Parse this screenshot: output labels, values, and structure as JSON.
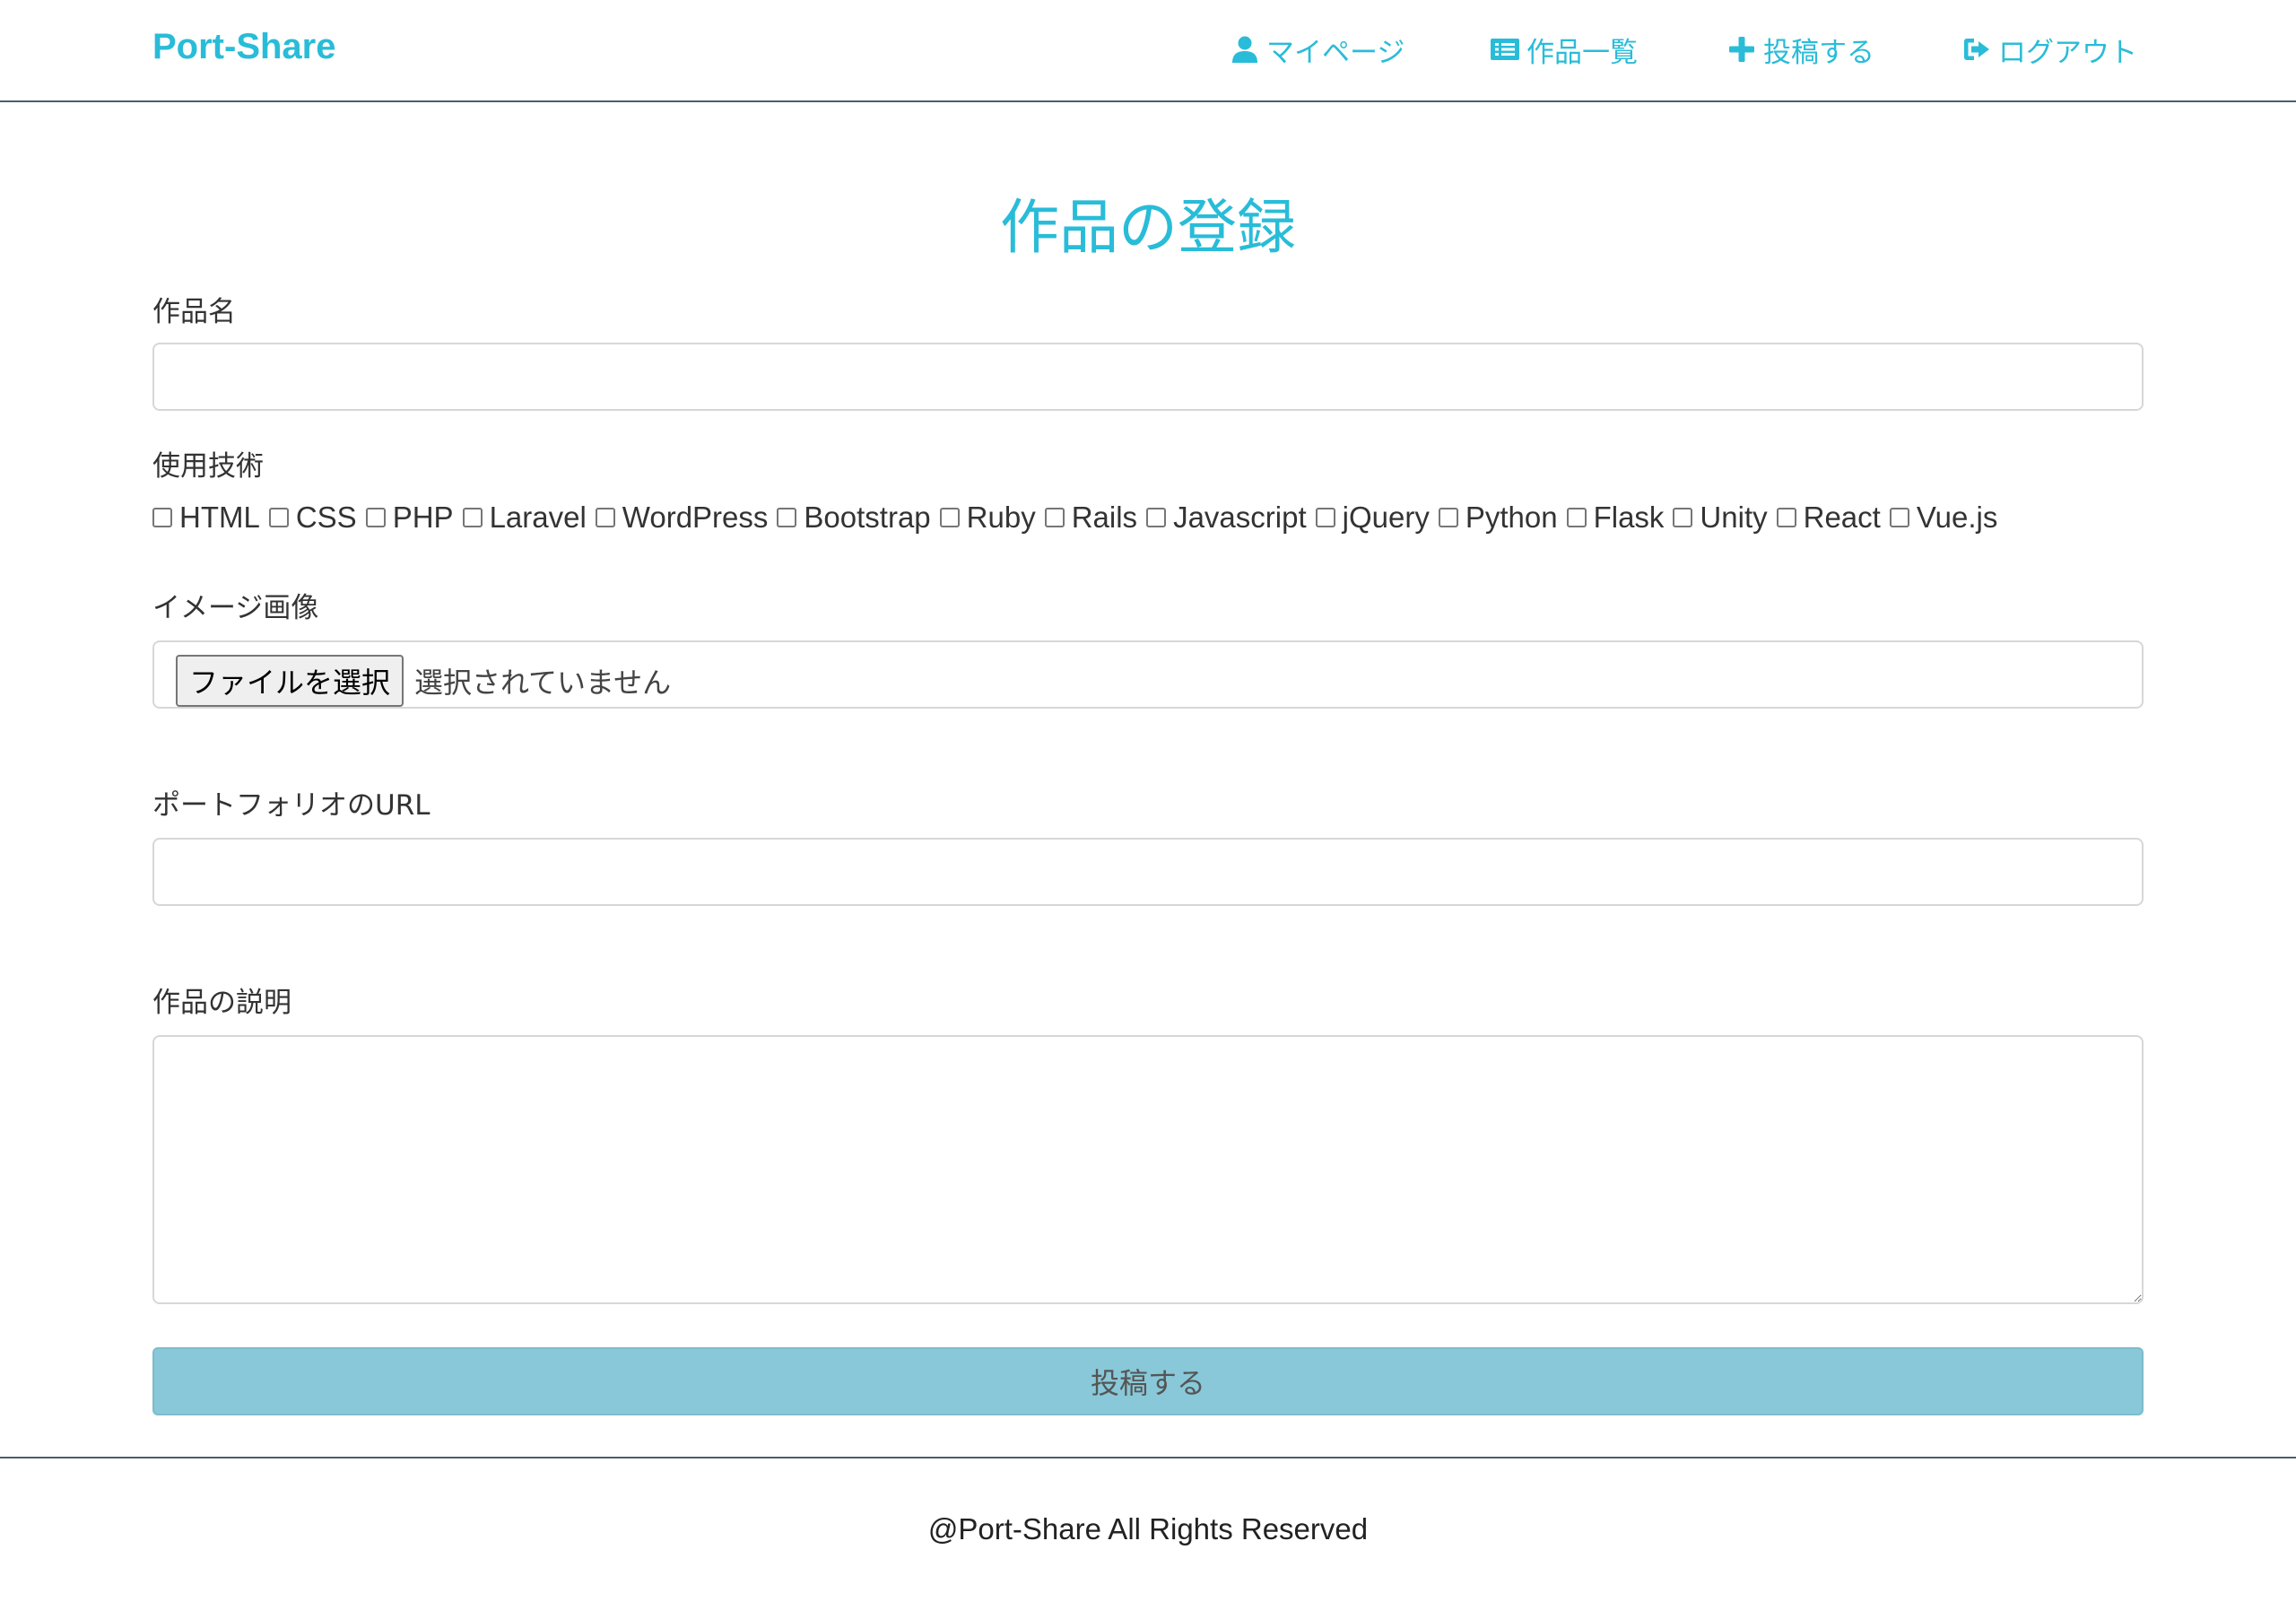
{
  "header": {
    "logo": "Port-Share",
    "nav": {
      "mypage": {
        "label": "マイページ",
        "icon": "user-icon"
      },
      "list": {
        "label": "作品一覧",
        "icon": "list-icon"
      },
      "post": {
        "label": "投稿する",
        "icon": "plus-icon"
      },
      "logout": {
        "label": "ログアウト",
        "icon": "sign-out-icon"
      }
    }
  },
  "form": {
    "title": "作品の登録",
    "name_label": "作品名",
    "name_value": "",
    "tech_label": "使用技術",
    "technologies": [
      {
        "label": "HTML",
        "checked": false
      },
      {
        "label": "CSS",
        "checked": false
      },
      {
        "label": "PHP",
        "checked": false
      },
      {
        "label": "Laravel",
        "checked": false
      },
      {
        "label": "WordPress",
        "checked": false
      },
      {
        "label": "Bootstrap",
        "checked": false
      },
      {
        "label": "Ruby",
        "checked": false
      },
      {
        "label": "Rails",
        "checked": false
      },
      {
        "label": "Javascript",
        "checked": false
      },
      {
        "label": "jQuery",
        "checked": false
      },
      {
        "label": "Python",
        "checked": false
      },
      {
        "label": "Flask",
        "checked": false
      },
      {
        "label": "Unity",
        "checked": false
      },
      {
        "label": "React",
        "checked": false
      },
      {
        "label": "Vue.js",
        "checked": false
      }
    ],
    "image_label": "イメージ画像",
    "file_button": "ファイルを選択",
    "file_status": "選択されていません",
    "url_label": "ポートフォリオのURL",
    "url_value": "",
    "description_label": "作品の説明",
    "description_value": "",
    "submit_label": "投稿する"
  },
  "footer": {
    "text": "@Port-Share All Rights Reserved"
  },
  "colors": {
    "accent": "#29bcd8",
    "submit_bg": "#88c8d8",
    "divider": "#4a5f6c"
  }
}
